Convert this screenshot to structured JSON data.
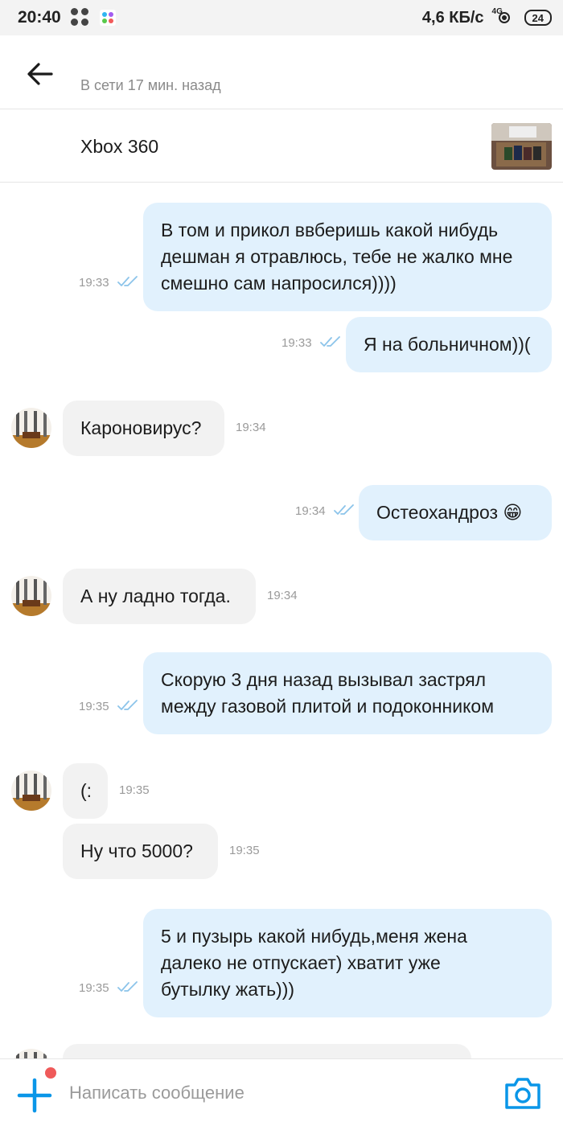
{
  "status_bar": {
    "time": "20:40",
    "speed": "4,6 КБ/с",
    "signal": "4G",
    "battery": "24"
  },
  "header": {
    "status": "В сети 17 мин. назад"
  },
  "item": {
    "title": "Xbox 360"
  },
  "messages": [
    {
      "side": "out",
      "lines": [
        "В том и прикол ввберишь какой нибудь",
        "дешман я отравлюсь, тебе не жалко мне",
        "смешно сам напросился))))"
      ],
      "time": "19:33",
      "read": true
    },
    {
      "side": "out",
      "lines": [
        "Я на больничном))("
      ],
      "time": "19:33",
      "read": true
    },
    {
      "side": "in",
      "lines": [
        "Кароновирус?"
      ],
      "time": "19:34"
    },
    {
      "side": "out",
      "lines": [
        "Остеохандроз 😁"
      ],
      "time": "19:34",
      "read": true
    },
    {
      "side": "in",
      "lines": [
        "А ну ладно тогда."
      ],
      "time": "19:34"
    },
    {
      "side": "out",
      "lines": [
        "Скорую 3 дня назад вызывал застрял",
        "между газовой плитой и подоконником"
      ],
      "time": "19:35",
      "read": true
    },
    {
      "side": "in",
      "lines": [
        "(:"
      ],
      "time": "19:35"
    },
    {
      "side": "in",
      "lines": [
        "Ну что 5000?"
      ],
      "time": "19:35"
    },
    {
      "side": "out",
      "lines": [
        "5 и пузырь какой нибудь,меня жена",
        "далеко не отпускает) хватит уже",
        "бутылку жать)))"
      ],
      "time": "19:35",
      "read": true
    }
  ],
  "composer": {
    "placeholder": "Написать сообщение"
  },
  "colors": {
    "outgoing_bubble": "#e1f1fd",
    "incoming_bubble": "#f2f2f2",
    "accent": "#0a96e8",
    "badge": "#ef5a5a"
  }
}
